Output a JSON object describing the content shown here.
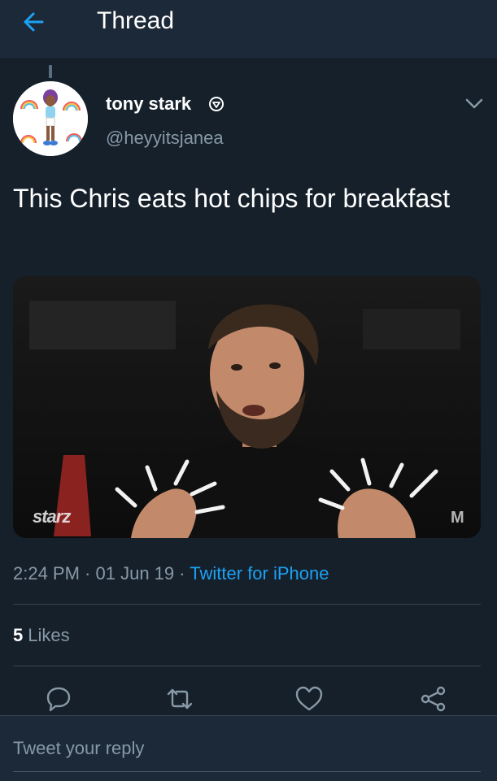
{
  "header": {
    "title": "Thread",
    "back_icon": "back-arrow-icon"
  },
  "tweet": {
    "display_name": "tony stark",
    "handle": "@heyyitsjanea",
    "text": "This Chris eats hot chips for breakfast",
    "media": {
      "logo_text": "starz",
      "corner_mark": "M"
    },
    "time": "2:24 PM",
    "date": "01 Jun 19",
    "separator": " · ",
    "source": "Twitter for iPhone",
    "likes_count": "5",
    "likes_label": "Likes"
  },
  "actions": {
    "reply_icon": "reply-icon",
    "retweet_icon": "retweet-icon",
    "like_icon": "heart-icon",
    "share_icon": "share-icon"
  },
  "reply": {
    "placeholder": "Tweet your reply"
  },
  "colors": {
    "background": "#15202b",
    "header": "#1c2938",
    "accent": "#1da1f2",
    "secondary_text": "#8899a6",
    "divider": "#38444d"
  }
}
